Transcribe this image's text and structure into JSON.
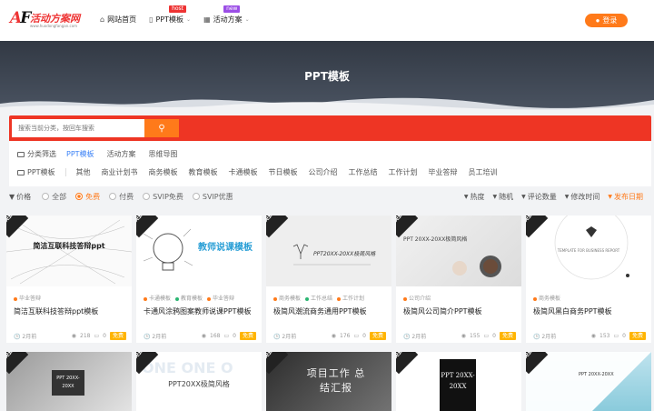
{
  "logo": {
    "mark": "AF",
    "name": "活动方案网",
    "url": "www.huodongfangan.com"
  },
  "nav": [
    {
      "label": "网站首页",
      "icon": "home-icon",
      "badge": ""
    },
    {
      "label": "PPT模板",
      "icon": "document-icon",
      "badge": "host"
    },
    {
      "label": "活动方案",
      "icon": "grid-icon",
      "badge": "new"
    }
  ],
  "login": {
    "label": "登录"
  },
  "banner": {
    "title": "PPT模板"
  },
  "search": {
    "placeholder": "搜索当前分类，按回车搜索"
  },
  "filters": {
    "row1": {
      "head": "分类筛选",
      "options": [
        "PPT模板",
        "活动方案",
        "思维导图"
      ],
      "active": 0
    },
    "row2": {
      "head": "PPT模板",
      "options": [
        "其他",
        "商业计划书",
        "商务模板",
        "教育模板",
        "卡通模板",
        "节日模板",
        "公司介绍",
        "工作总结",
        "工作计划",
        "毕业答辩",
        "员工培训"
      ]
    }
  },
  "price": {
    "label": "价格",
    "options": [
      "全部",
      "免费",
      "付费",
      "SVIP免费",
      "SVIP优惠"
    ],
    "active": 1
  },
  "sort": {
    "options": [
      "热度",
      "随机",
      "评论数量",
      "修改时间",
      "发布日期"
    ],
    "active": 4
  },
  "colors": {
    "accent": "#ff7a1a",
    "red": "#ee3524",
    "blue": "#3b82f6",
    "price": "#ffb400"
  },
  "cards": [
    {
      "free": "免费",
      "thumb_text": "简洁互联科技答辩ppt",
      "tags": [
        {
          "label": "毕业答辩",
          "color": "#ff7a1a"
        }
      ],
      "title": "简洁互联科技答辩ppt模板",
      "time": "2月前",
      "views": "218",
      "comments": "0",
      "price": "免费"
    },
    {
      "free": "免费",
      "thumb_text": "教师说课模板",
      "tags": [
        {
          "label": "卡通模板",
          "color": "#ff7a1a"
        },
        {
          "label": "教育模板",
          "color": "#2bb673"
        },
        {
          "label": "毕业答辩",
          "color": "#ff7a1a"
        }
      ],
      "title": "卡通风涂鸦图案教师说课PPT模板",
      "time": "2月前",
      "views": "168",
      "comments": "0",
      "price": "免费"
    },
    {
      "free": "免费",
      "thumb_text": "PPT20XX-20XX极简风格",
      "tags": [
        {
          "label": "商务模板",
          "color": "#ff7a1a"
        },
        {
          "label": "工作总结",
          "color": "#2bb673"
        },
        {
          "label": "工作计划",
          "color": "#ff7a1a"
        }
      ],
      "title": "极简风潮流商务通用PPT模板",
      "time": "2月前",
      "views": "176",
      "comments": "0",
      "price": "免费"
    },
    {
      "free": "免费",
      "thumb_text": "PPT 20XX-20XX极简风格",
      "tags": [
        {
          "label": "公司介绍",
          "color": "#ff7a1a"
        }
      ],
      "title": "极简风公司简介PPT模板",
      "time": "2月前",
      "views": "155",
      "comments": "0",
      "price": "免费"
    },
    {
      "free": "免费",
      "thumb_text": "TEMPLATE FOR BUSINESS REPORT",
      "tags": [
        {
          "label": "商务模板",
          "color": "#ff7a1a"
        }
      ],
      "title": "极简风黑白商务PPT模板",
      "time": "2月前",
      "views": "153",
      "comments": "0",
      "price": "免费"
    },
    {
      "free": "免费",
      "thumb_text": "PPT 20XX-20XX",
      "tags": [],
      "title": "",
      "time": "",
      "views": "",
      "comments": "",
      "price": ""
    },
    {
      "free": "免费",
      "thumb_text": "PPT20XX极简风格",
      "tags": [],
      "title": "",
      "time": "",
      "views": "",
      "comments": "",
      "price": ""
    },
    {
      "free": "免费",
      "thumb_text": "项目工作 总结汇报",
      "tags": [],
      "title": "",
      "time": "",
      "views": "",
      "comments": "",
      "price": ""
    },
    {
      "free": "免费",
      "thumb_text": "PPT 20XX- 20XX",
      "tags": [],
      "title": "",
      "time": "",
      "views": "",
      "comments": "",
      "price": ""
    },
    {
      "free": "免费",
      "thumb_text": "PPT 20XX-20XX",
      "tags": [],
      "title": "",
      "time": "",
      "views": "",
      "comments": "",
      "price": ""
    }
  ]
}
